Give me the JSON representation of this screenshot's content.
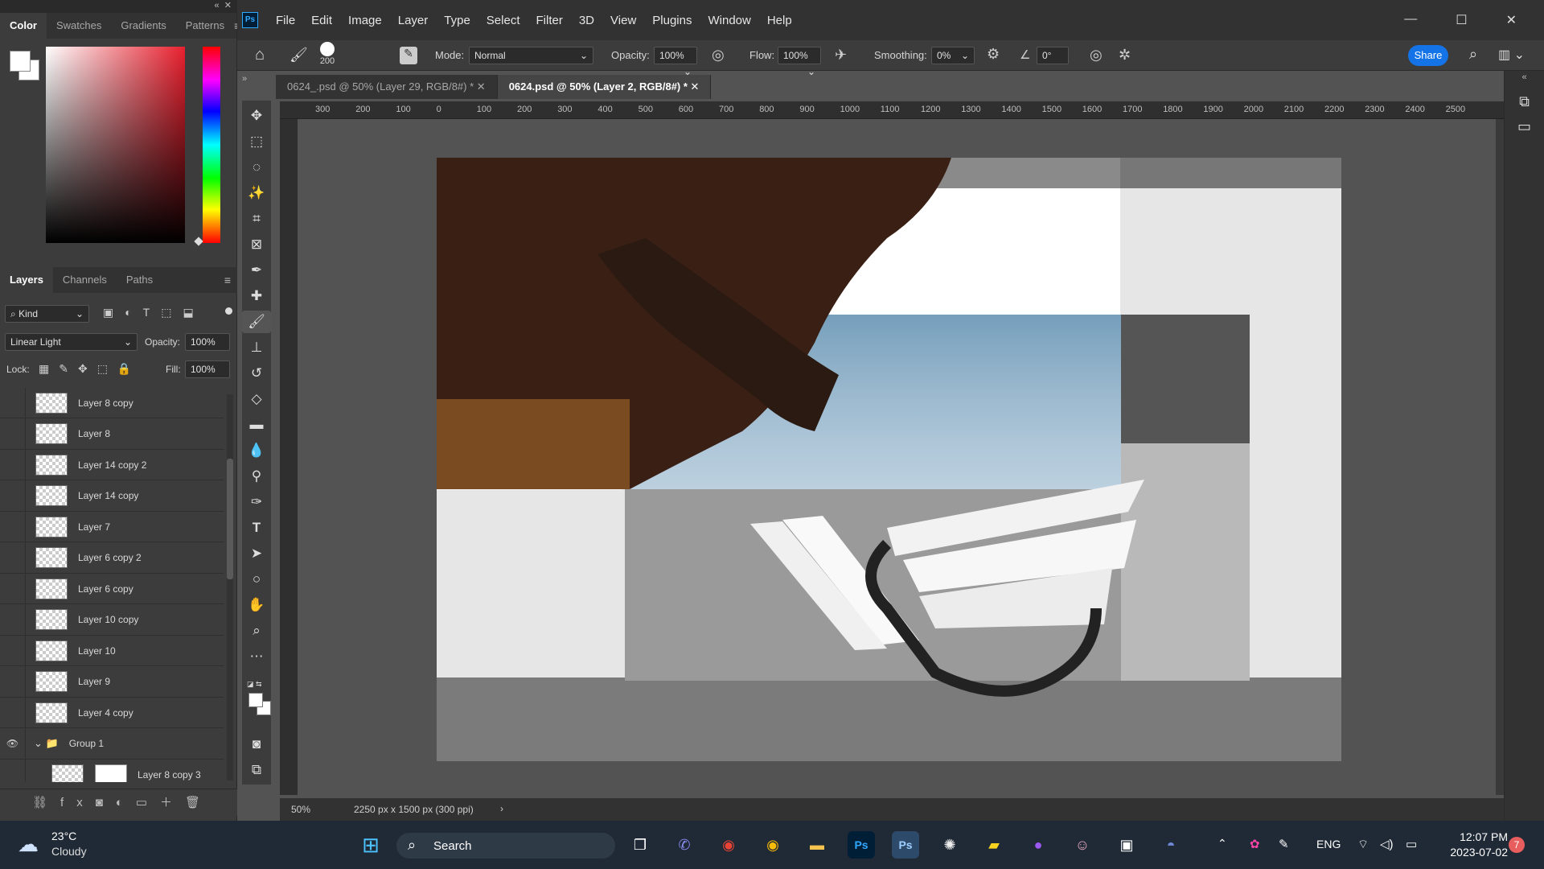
{
  "color_panel": {
    "tabs": [
      "Color",
      "Swatches",
      "Gradients",
      "Patterns"
    ]
  },
  "layers_panel": {
    "tabs": [
      "Layers",
      "Channels",
      "Paths"
    ],
    "filter_kind": "Kind",
    "blend_mode": "Linear Light",
    "opacity_label": "Opacity:",
    "opacity_value": "100%",
    "lock_label": "Lock:",
    "fill_label": "Fill:",
    "fill_value": "100%",
    "layers": [
      {
        "name": "Layer 8 copy"
      },
      {
        "name": "Layer 8"
      },
      {
        "name": "Layer 14 copy 2"
      },
      {
        "name": "Layer 14 copy"
      },
      {
        "name": "Layer 7"
      },
      {
        "name": "Layer 6 copy 2"
      },
      {
        "name": "Layer 6 copy"
      },
      {
        "name": "Layer 10 copy"
      },
      {
        "name": "Layer 10"
      },
      {
        "name": "Layer 9"
      },
      {
        "name": "Layer 4 copy"
      },
      {
        "name": "Group 1"
      },
      {
        "name": "Layer 8 copy 3"
      }
    ]
  },
  "menu": [
    "File",
    "Edit",
    "Image",
    "Layer",
    "Type",
    "Select",
    "Filter",
    "3D",
    "View",
    "Plugins",
    "Window",
    "Help"
  ],
  "options": {
    "brush_size": "200",
    "mode_label": "Mode:",
    "mode_value": "Normal",
    "opacity_label": "Opacity:",
    "opacity_value": "100%",
    "flow_label": "Flow:",
    "flow_value": "100%",
    "smoothing_label": "Smoothing:",
    "smoothing_value": "0%",
    "angle_value": "0°",
    "share_label": "Share"
  },
  "doc_tabs": [
    {
      "label": "0624_.psd @ 50% (Layer 29, RGB/8#) *",
      "active": false
    },
    {
      "label": "0624.psd @ 50% (Layer 2, RGB/8#) *",
      "active": true
    }
  ],
  "ruler_h": [
    "300",
    "200",
    "100",
    "0",
    "100",
    "200",
    "300",
    "400",
    "500",
    "600",
    "700",
    "800",
    "900",
    "1000",
    "1100",
    "1200",
    "1300",
    "1400",
    "1500",
    "1600",
    "1700",
    "1800",
    "1900",
    "2000",
    "2100",
    "2200",
    "2300",
    "2400",
    "2500"
  ],
  "status": {
    "zoom": "50%",
    "doc_size": "2250 px x 1500 px (300 ppi)"
  },
  "taskbar": {
    "temp": "23°C",
    "weather": "Cloudy",
    "search_label": "Search",
    "lang": "ENG",
    "time": "12:07 PM",
    "date": "2023-07-02",
    "notif_count": "7"
  },
  "colors": {
    "share_button": "#1473e6",
    "accent": "#1473e6"
  }
}
